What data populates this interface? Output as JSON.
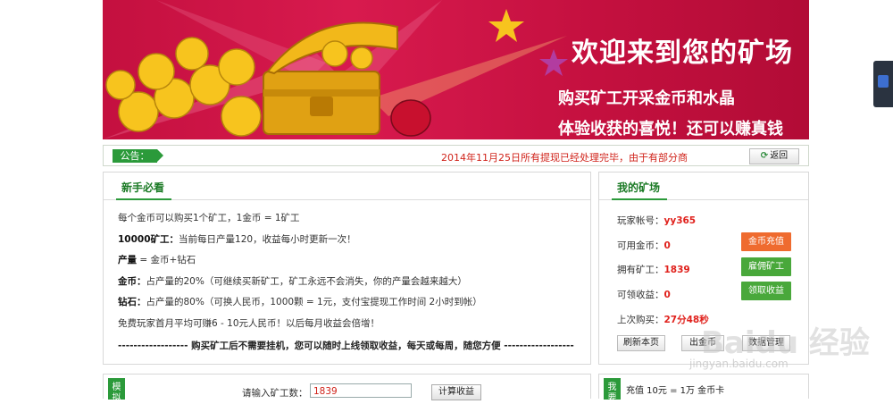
{
  "banner": {
    "title": "欢迎来到您的矿场",
    "line1": "购买矿工开采金币和水晶",
    "line2": "体验收获的喜悦！还可以赚真钱哦！"
  },
  "notice": {
    "tag": "公告：",
    "text": "2014年11月25日所有提现已经处理完毕，由于有部分商",
    "back_label": "返回"
  },
  "guide": {
    "title": "新手必看",
    "lines": [
      {
        "bold": "",
        "text": "每个金币可以购买1个矿工，1金币 = 1矿工"
      },
      {
        "bold": "10000矿工：",
        "text": "当前每日产量120，收益每小时更新一次！"
      },
      {
        "bold": "产量",
        "text": " = 金币+钻石"
      },
      {
        "bold": "金币：",
        "text": "占产量的20%（可继续买新矿工，矿工永远不会消失，你的产量会越来越大）"
      },
      {
        "bold": "钻石：",
        "text": "占产量的80%（可换人民币，1000颗 = 1元，支付宝提现工作时间 2小时到帐）"
      },
      {
        "bold": "",
        "text": "免费玩家首月平均可赚6 - 10元人民币！以后每月收益会倍增！"
      }
    ],
    "footer": "------------------ 购买矿工后不需要挂机，您可以随时上线领取收益，每天或每周，随您方便 ------------------"
  },
  "mine": {
    "title": "我的矿场",
    "account_label": "玩家帐号：",
    "account_value": "yy365",
    "coins_label": "可用金币：",
    "coins_value": "0",
    "miners_label": "拥有矿工：",
    "miners_value": "1839",
    "income_label": "可领收益：",
    "income_value": "0",
    "last_buy_label": "上次购买：",
    "last_buy_value": "27分48秒",
    "recharge_button": "金币充值",
    "hire_button": "雇佣矿工",
    "collect_button": "领取收益",
    "refresh_button": "刷新本页",
    "btn2": "出金币",
    "btn3": "数据管理"
  },
  "calc": {
    "side_tag": "模拟",
    "label": "请输入矿工数：",
    "input_value": "1839",
    "button": "计算收益"
  },
  "buy": {
    "side_tag": "我要",
    "text": "充值 10元 = 1万 金币卡"
  },
  "watermark": {
    "logo": "Baidu 经验",
    "url": "jingyan.baidu.com"
  },
  "colors": {
    "accent_green": "#2b9a3a",
    "banner_red": "#c4103f",
    "value_red": "#e0211c",
    "orange_button": "#ef6b2f"
  }
}
